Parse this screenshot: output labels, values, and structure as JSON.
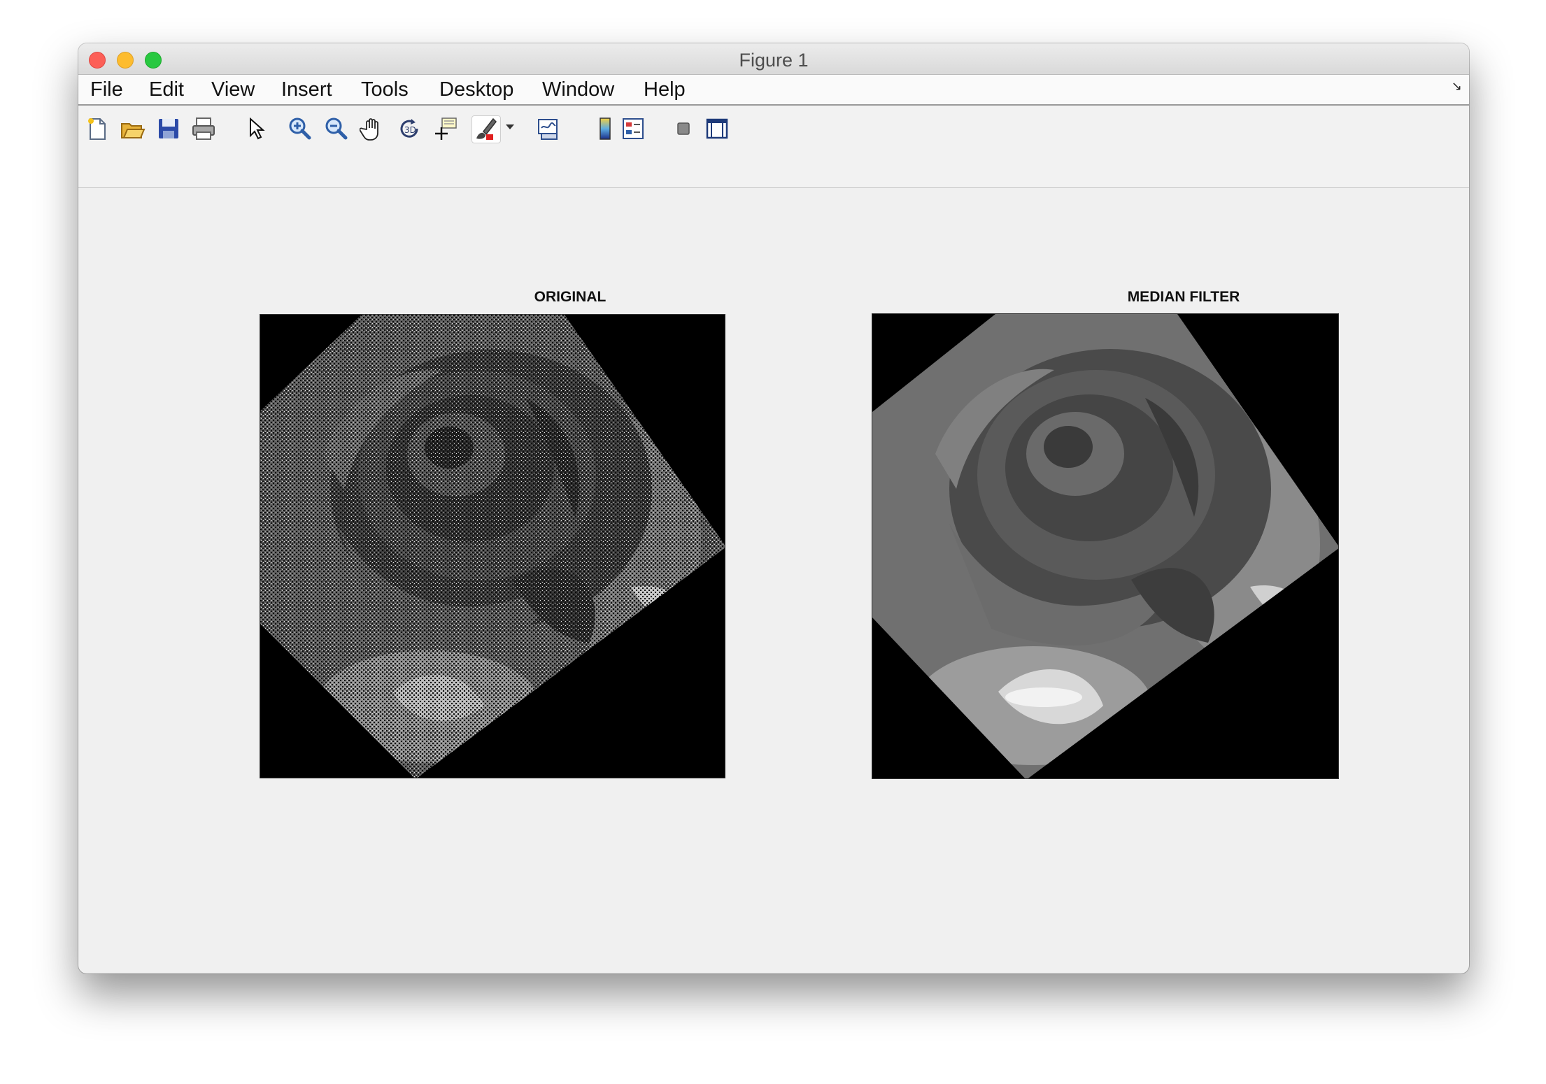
{
  "window": {
    "title": "Figure 1"
  },
  "menu": [
    "File",
    "Edit",
    "View",
    "Insert",
    "Tools",
    "Desktop",
    "Window",
    "Help"
  ],
  "toolbar": [
    {
      "name": "new-figure-icon"
    },
    {
      "name": "open-file-icon"
    },
    {
      "name": "save-icon"
    },
    {
      "name": "print-icon"
    },
    {
      "name": "edit-plot-pointer-icon"
    },
    {
      "name": "zoom-in-icon"
    },
    {
      "name": "zoom-out-icon"
    },
    {
      "name": "pan-hand-icon"
    },
    {
      "name": "rotate-3d-icon"
    },
    {
      "name": "data-cursor-icon"
    },
    {
      "name": "brush-icon"
    },
    {
      "name": "link-plot-icon"
    },
    {
      "name": "insert-colorbar-icon"
    },
    {
      "name": "insert-legend-icon"
    },
    {
      "name": "hide-plot-tools-icon"
    },
    {
      "name": "show-plot-tools-icon"
    }
  ],
  "figures": [
    {
      "title": "ORIGINAL",
      "image": "rotated grayscale rose with salt-and-pepper noise"
    },
    {
      "title": "MEDIAN FILTER",
      "image": "rotated grayscale rose after median filtering"
    }
  ]
}
